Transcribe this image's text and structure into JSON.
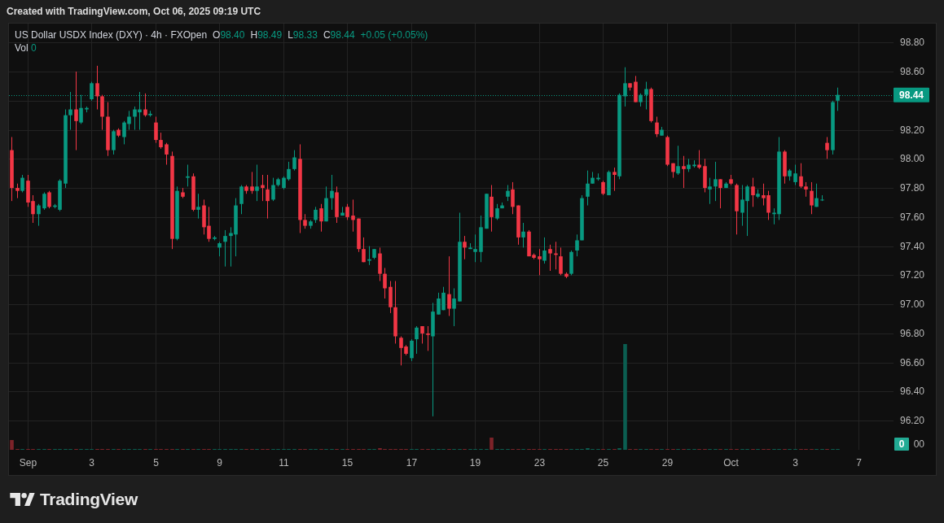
{
  "caption": "Created with TradingView.com, Oct 06, 2025 09:19 UTC",
  "legend": {
    "symbol": "US Dollar USDX Index (DXY) · 4h · FXOpen",
    "ohlc": [
      {
        "label": "O",
        "value": "98.40"
      },
      {
        "label": "H",
        "value": "98.49"
      },
      {
        "label": "L",
        "value": "98.33"
      },
      {
        "label": "C",
        "value": "98.44"
      }
    ],
    "change": "+0.05 (+0.05%)",
    "volume": {
      "label": "Vol",
      "value": "0"
    }
  },
  "chart": {
    "chart_data": {
      "type": "candlestick",
      "grid": true,
      "ylim": [
        96.0,
        98.93
      ],
      "categories": [
        null,
        null,
        null,
        "Sep",
        null,
        null,
        null,
        null,
        null,
        null,
        null,
        null,
        null,
        null,
        null,
        "3",
        null,
        null,
        null,
        null,
        null,
        null,
        null,
        null,
        null,
        null,
        null,
        "5",
        null,
        null,
        null,
        null,
        null,
        null,
        null,
        null,
        null,
        null,
        null,
        "9",
        null,
        null,
        null,
        null,
        null,
        null,
        null,
        null,
        null,
        null,
        null,
        "11",
        null,
        null,
        null,
        null,
        null,
        null,
        null,
        null,
        null,
        null,
        null,
        "15",
        null,
        null,
        null,
        null,
        null,
        null,
        null,
        null,
        null,
        null,
        null,
        "17",
        null,
        null,
        null,
        null,
        null,
        null,
        null,
        null,
        null,
        null,
        null,
        "19",
        null,
        null,
        null,
        null,
        null,
        null,
        null,
        null,
        null,
        null,
        null,
        "23",
        null,
        null,
        null,
        null,
        null,
        null,
        null,
        null,
        null,
        null,
        null,
        "25",
        null,
        null,
        null,
        null,
        null,
        null,
        null,
        null,
        null,
        null,
        null,
        "29",
        null,
        null,
        null,
        null,
        null,
        null,
        null,
        null,
        null,
        null,
        null,
        "Oct",
        null,
        null,
        null,
        null,
        null,
        null,
        null,
        null,
        null,
        null,
        null,
        "3",
        null,
        null,
        null,
        null,
        null,
        null,
        null,
        null,
        null,
        null,
        null,
        "7",
        null,
        null,
        null,
        null,
        null,
        null
      ],
      "yticks": [
        {
          "value": 96.2,
          "label": "96.20"
        },
        {
          "value": 96.4,
          "label": "96.40"
        },
        {
          "value": 96.6,
          "label": "96.60"
        },
        {
          "value": 96.8,
          "label": "96.80"
        },
        {
          "value": 97.0,
          "label": "97.00"
        },
        {
          "value": 97.2,
          "label": "97.20"
        },
        {
          "value": 97.4,
          "label": "97.40"
        },
        {
          "value": 97.6,
          "label": "97.60"
        },
        {
          "value": 97.8,
          "label": "97.80"
        },
        {
          "value": 98.0,
          "label": "98.00"
        },
        {
          "value": 98.2,
          "label": "98.20"
        },
        {
          "value": 98.6,
          "label": "98.60"
        },
        {
          "value": 98.8,
          "label": "98.80"
        }
      ],
      "ref_lines": [
        {
          "axis": "y",
          "value": 98.44,
          "label": "98.44",
          "color": "#089981"
        }
      ],
      "ohlc": [
        [
          98.06,
          98.15,
          97.71,
          97.8
        ],
        [
          97.8,
          97.83,
          97.73,
          97.78
        ],
        [
          97.78,
          97.89,
          97.77,
          97.87
        ],
        [
          97.85,
          97.89,
          97.67,
          97.7
        ],
        [
          97.71,
          97.75,
          97.56,
          97.62
        ],
        [
          97.62,
          97.69,
          97.54,
          97.68
        ],
        [
          97.66,
          97.77,
          97.65,
          97.76
        ],
        [
          97.77,
          97.78,
          97.66,
          97.67
        ],
        [
          97.67,
          97.69,
          97.66,
          97.68
        ],
        [
          97.65,
          97.86,
          97.64,
          97.85
        ],
        [
          97.83,
          98.34,
          97.8,
          98.3
        ],
        [
          98.3,
          98.46,
          98.2,
          98.34
        ],
        [
          98.34,
          98.6,
          98.06,
          98.26
        ],
        [
          98.25,
          98.44,
          98.24,
          98.35
        ],
        [
          98.34,
          98.36,
          98.32,
          98.35
        ],
        [
          98.41,
          98.53,
          98.4,
          98.52
        ],
        [
          98.52,
          98.64,
          98.34,
          98.43
        ],
        [
          98.43,
          98.44,
          98.2,
          98.29
        ],
        [
          98.29,
          98.39,
          98.02,
          98.06
        ],
        [
          98.06,
          98.2,
          98.03,
          98.19
        ],
        [
          98.2,
          98.21,
          98.15,
          98.16
        ],
        [
          98.15,
          98.26,
          98.1,
          98.25
        ],
        [
          98.24,
          98.33,
          98.2,
          98.29
        ],
        [
          98.29,
          98.36,
          98.2,
          98.34
        ],
        [
          98.32,
          98.46,
          98.2,
          98.34
        ],
        [
          98.34,
          98.45,
          98.29,
          98.3
        ],
        [
          98.3,
          98.33,
          98.29,
          98.31
        ],
        [
          98.25,
          98.29,
          98.11,
          98.13
        ],
        [
          98.13,
          98.18,
          98.07,
          98.08
        ],
        [
          98.1,
          98.11,
          97.96,
          98.03
        ],
        [
          98.02,
          98.05,
          97.38,
          97.45
        ],
        [
          97.45,
          97.81,
          97.44,
          97.78
        ],
        [
          97.77,
          97.8,
          97.73,
          97.74
        ],
        [
          97.87,
          97.96,
          97.81,
          97.88
        ],
        [
          97.88,
          97.9,
          97.64,
          97.65
        ],
        [
          97.65,
          97.76,
          97.59,
          97.67
        ],
        [
          97.68,
          97.72,
          97.48,
          97.53
        ],
        [
          97.54,
          97.67,
          97.43,
          97.45
        ],
        [
          97.45,
          97.47,
          97.44,
          97.46
        ],
        [
          97.39,
          97.43,
          97.33,
          97.42
        ],
        [
          97.43,
          97.51,
          97.26,
          97.47
        ],
        [
          97.47,
          97.53,
          97.26,
          97.49
        ],
        [
          97.48,
          97.73,
          97.33,
          97.68
        ],
        [
          97.69,
          97.82,
          97.62,
          97.81
        ],
        [
          97.81,
          97.82,
          97.76,
          97.78
        ],
        [
          97.81,
          97.91,
          97.76,
          97.78
        ],
        [
          97.78,
          97.96,
          97.71,
          97.81
        ],
        [
          97.82,
          97.89,
          97.71,
          97.8
        ],
        [
          97.79,
          97.89,
          97.59,
          97.71
        ],
        [
          97.72,
          97.87,
          97.71,
          97.82
        ],
        [
          97.82,
          97.87,
          97.81,
          97.86
        ],
        [
          97.8,
          97.88,
          97.79,
          97.87
        ],
        [
          97.86,
          97.98,
          97.85,
          97.93
        ],
        [
          97.93,
          98.06,
          97.92,
          98.01
        ],
        [
          98.0,
          98.1,
          97.49,
          97.58
        ],
        [
          97.58,
          97.62,
          97.52,
          97.54
        ],
        [
          97.54,
          97.58,
          97.52,
          97.57
        ],
        [
          97.58,
          97.67,
          97.56,
          97.65
        ],
        [
          97.66,
          97.69,
          97.5,
          97.57
        ],
        [
          97.57,
          97.81,
          97.57,
          97.73
        ],
        [
          97.73,
          97.89,
          97.65,
          97.78
        ],
        [
          97.77,
          97.81,
          97.56,
          97.6
        ],
        [
          97.61,
          97.67,
          97.61,
          97.63
        ],
        [
          97.67,
          97.69,
          97.58,
          97.6
        ],
        [
          97.61,
          97.72,
          97.5,
          97.58
        ],
        [
          97.59,
          97.59,
          97.36,
          97.38
        ],
        [
          97.38,
          97.46,
          97.29,
          97.29
        ],
        [
          97.3,
          97.4,
          97.27,
          97.31
        ],
        [
          97.32,
          97.38,
          97.31,
          97.38
        ],
        [
          97.35,
          97.39,
          97.16,
          97.21
        ],
        [
          97.21,
          97.25,
          97.04,
          97.11
        ],
        [
          97.12,
          97.16,
          96.94,
          96.98
        ],
        [
          96.98,
          97.16,
          96.73,
          96.78
        ],
        [
          96.77,
          96.78,
          96.58,
          96.7
        ],
        [
          96.71,
          96.72,
          96.65,
          96.66
        ],
        [
          96.63,
          96.76,
          96.61,
          96.75
        ],
        [
          96.76,
          96.85,
          96.66,
          96.84
        ],
        [
          96.85,
          96.85,
          96.73,
          96.8
        ],
        [
          96.8,
          96.85,
          96.68,
          96.79
        ],
        [
          96.78,
          97.01,
          96.23,
          96.95
        ],
        [
          96.93,
          97.08,
          96.93,
          97.04
        ],
        [
          96.96,
          97.12,
          96.96,
          97.08
        ],
        [
          97.07,
          97.33,
          96.92,
          96.97
        ],
        [
          96.97,
          97.11,
          96.85,
          97.04
        ],
        [
          97.02,
          97.63,
          97.02,
          97.43
        ],
        [
          97.43,
          97.47,
          97.31,
          97.39
        ],
        [
          97.38,
          97.42,
          97.38,
          97.39
        ],
        [
          97.36,
          97.48,
          97.29,
          97.38
        ],
        [
          97.36,
          97.61,
          97.29,
          97.53
        ],
        [
          97.52,
          97.76,
          97.52,
          97.76
        ],
        [
          97.74,
          97.82,
          97.5,
          97.6
        ],
        [
          97.59,
          97.69,
          97.58,
          97.66
        ],
        [
          97.66,
          97.7,
          97.66,
          97.68
        ],
        [
          97.74,
          97.82,
          97.71,
          97.78
        ],
        [
          97.79,
          97.84,
          97.62,
          97.67
        ],
        [
          97.68,
          97.68,
          97.41,
          97.46
        ],
        [
          97.46,
          97.56,
          97.39,
          97.5
        ],
        [
          97.5,
          97.51,
          97.33,
          97.33
        ],
        [
          97.34,
          97.35,
          97.31,
          97.32
        ],
        [
          97.33,
          97.38,
          97.2,
          97.31
        ],
        [
          97.3,
          97.46,
          97.28,
          97.37
        ],
        [
          97.38,
          97.41,
          97.23,
          97.35
        ],
        [
          97.35,
          97.43,
          97.24,
          97.34
        ],
        [
          97.33,
          97.39,
          97.2,
          97.21
        ],
        [
          97.21,
          97.22,
          97.18,
          97.19
        ],
        [
          97.21,
          97.37,
          97.2,
          97.36
        ],
        [
          97.37,
          97.48,
          97.33,
          97.44
        ],
        [
          97.44,
          97.75,
          97.44,
          97.73
        ],
        [
          97.74,
          97.92,
          97.68,
          97.83
        ],
        [
          97.83,
          97.91,
          97.83,
          97.87
        ],
        [
          97.86,
          97.9,
          97.85,
          97.87
        ],
        [
          97.84,
          97.85,
          97.75,
          97.76
        ],
        [
          97.75,
          97.92,
          97.75,
          97.91
        ],
        [
          97.91,
          97.94,
          97.78,
          97.89
        ],
        [
          97.88,
          98.45,
          97.86,
          98.44
        ],
        [
          98.43,
          98.63,
          98.36,
          98.52
        ],
        [
          98.52,
          98.52,
          98.47,
          98.49
        ],
        [
          98.53,
          98.57,
          98.39,
          98.39
        ],
        [
          98.39,
          98.45,
          98.36,
          98.44
        ],
        [
          98.44,
          98.53,
          98.34,
          98.48
        ],
        [
          98.48,
          98.49,
          98.25,
          98.26
        ],
        [
          98.25,
          98.29,
          98.15,
          98.17
        ],
        [
          98.16,
          98.22,
          98.16,
          98.2
        ],
        [
          98.15,
          98.16,
          97.95,
          97.96
        ],
        [
          97.97,
          97.97,
          97.87,
          97.91
        ],
        [
          97.9,
          98.09,
          97.89,
          97.95
        ],
        [
          97.95,
          98.02,
          97.8,
          97.93
        ],
        [
          97.93,
          98.0,
          97.91,
          97.96
        ],
        [
          97.95,
          97.99,
          97.94,
          97.96
        ],
        [
          97.96,
          98.06,
          97.93,
          97.94
        ],
        [
          97.95,
          98.0,
          97.77,
          97.8
        ],
        [
          97.79,
          97.87,
          97.69,
          97.81
        ],
        [
          97.81,
          97.98,
          97.71,
          97.86
        ],
        [
          97.86,
          97.86,
          97.66,
          97.8
        ],
        [
          97.8,
          97.84,
          97.8,
          97.83
        ],
        [
          97.86,
          97.89,
          97.82,
          97.83
        ],
        [
          97.82,
          97.83,
          97.48,
          97.64
        ],
        [
          97.63,
          97.82,
          97.54,
          97.72
        ],
        [
          97.71,
          97.82,
          97.47,
          97.81
        ],
        [
          97.81,
          97.87,
          97.67,
          97.75
        ],
        [
          97.74,
          97.79,
          97.73,
          97.76
        ],
        [
          97.75,
          97.83,
          97.68,
          97.73
        ],
        [
          97.75,
          97.78,
          97.58,
          97.63
        ],
        [
          97.62,
          97.66,
          97.55,
          97.63
        ],
        [
          97.62,
          98.15,
          97.58,
          98.05
        ],
        [
          98.05,
          98.06,
          97.83,
          97.88
        ],
        [
          97.88,
          97.93,
          97.85,
          97.92
        ],
        [
          97.84,
          97.96,
          97.82,
          97.9
        ],
        [
          97.88,
          97.97,
          97.8,
          97.81
        ],
        [
          97.81,
          97.84,
          97.74,
          97.79
        ],
        [
          97.78,
          97.84,
          97.62,
          97.68
        ],
        [
          97.67,
          97.83,
          97.67,
          97.73
        ],
        [
          97.72,
          97.75,
          97.71,
          97.72
        ],
        [
          98.11,
          98.15,
          98.0,
          98.06
        ],
        [
          98.06,
          98.4,
          98.03,
          98.39
        ],
        [
          98.4,
          98.49,
          98.33,
          98.44
        ],
        null,
        null,
        null,
        null,
        null,
        null,
        null,
        null,
        null,
        null
      ]
    },
    "axis_fragment": "00"
  },
  "volume": {
    "badge": "0"
  },
  "footer": {
    "logo_text": "TradingView"
  }
}
